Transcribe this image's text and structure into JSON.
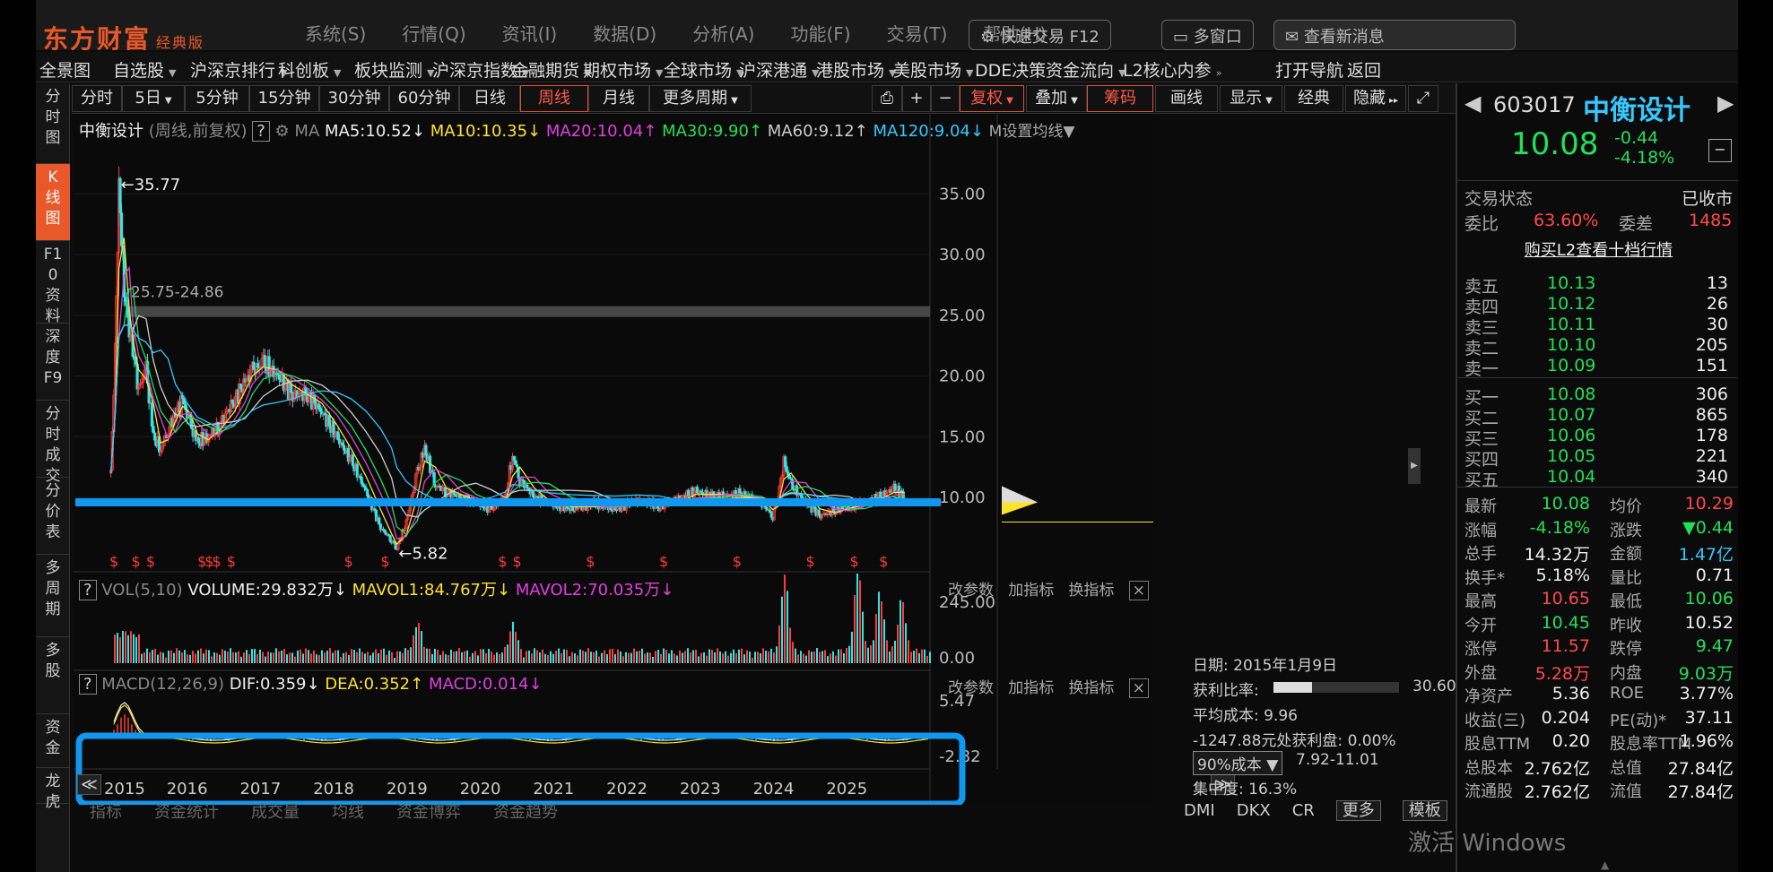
{
  "top_strip": {
    "logo": "东方财富",
    "logo_sub": "经典版",
    "menus": [
      "系统(S)",
      "行情(Q)",
      "资讯(I)",
      "数据(D)",
      "分析(A)",
      "功能(F)",
      "交易(T)",
      "帮助(H)"
    ],
    "search_pill": "快速交易 F12",
    "msg_pill": "多窗口",
    "news_pill": "查看新消息"
  },
  "main_nav": [
    {
      "label": "全景图",
      "arrow": ""
    },
    {
      "label": "自选股",
      "arrow": "▼"
    },
    {
      "label": "沪深京排行",
      "arrow": "▼"
    },
    {
      "label": "科创板",
      "arrow": "▼"
    },
    {
      "label": "板块监测",
      "arrow": "▼"
    },
    {
      "label": "沪深京指数",
      "arrow": "▼"
    },
    {
      "label": "金融期货",
      "arrow": "▼"
    },
    {
      "label": "期权市场",
      "arrow": "▼"
    },
    {
      "label": "全球市场",
      "arrow": "▼"
    },
    {
      "label": "沪深港通",
      "arrow": "▼"
    },
    {
      "label": "港股市场",
      "arrow": "▼"
    },
    {
      "label": "美股市场",
      "arrow": "▼"
    },
    {
      "label": "DDE决策",
      "arrow": ""
    },
    {
      "label": "资金流向",
      "arrow": "▼"
    },
    {
      "label": "L2核心内参",
      "arrow": "»"
    },
    {
      "label": "打开导航",
      "arrow": ""
    },
    {
      "label": "返回",
      "arrow": ""
    }
  ],
  "side_tabs": [
    {
      "label": "分时图",
      "active": false
    },
    {
      "label": "K线图",
      "active": true
    },
    {
      "label": "F10资料",
      "active": false
    },
    {
      "label": "深度F9",
      "active": false
    },
    {
      "label": "分时成交",
      "active": false
    },
    {
      "label": "分价表",
      "active": false
    },
    {
      "label": "多周期",
      "active": false
    },
    {
      "label": "多股",
      "active": false
    },
    {
      "label": "资金",
      "active": false
    },
    {
      "label": "龙虎",
      "active": false
    }
  ],
  "toolbar": {
    "periods": [
      {
        "label": "分时",
        "arrow": "",
        "active": false
      },
      {
        "label": "5日",
        "arrow": "▼",
        "active": false
      },
      {
        "label": "5分钟",
        "arrow": "",
        "active": false
      },
      {
        "label": "15分钟",
        "arrow": "",
        "active": false
      },
      {
        "label": "30分钟",
        "arrow": "",
        "active": false
      },
      {
        "label": "60分钟",
        "arrow": "",
        "active": false
      },
      {
        "label": "日线",
        "arrow": "",
        "active": false
      },
      {
        "label": "周线",
        "arrow": "",
        "active": true
      },
      {
        "label": "月线",
        "arrow": "",
        "active": false
      },
      {
        "label": "更多周期",
        "arrow": "▼",
        "active": false
      }
    ],
    "tools": [
      {
        "label": "⎙",
        "arrow": "",
        "active": false
      },
      {
        "label": "+",
        "arrow": "",
        "active": false
      },
      {
        "label": "−",
        "arrow": "",
        "active": false
      },
      {
        "label": "复权",
        "arrow": "▼",
        "active": true
      },
      {
        "label": "叠加",
        "arrow": "▼",
        "active": false
      },
      {
        "label": "筹码",
        "arrow": "",
        "active": true
      },
      {
        "label": "画线",
        "arrow": "",
        "active": false
      },
      {
        "label": "显示",
        "arrow": "▼",
        "active": false
      },
      {
        "label": "经典",
        "arrow": "",
        "active": false
      },
      {
        "label": "隐藏",
        "arrow": "▸▸",
        "active": false
      },
      {
        "label": "⤢",
        "arrow": "",
        "active": false
      }
    ]
  },
  "kline_header": {
    "name": "中衡设计",
    "mode": "(周线,前复权)",
    "help": "?",
    "ma": "MA",
    "ma5": "MA5:10.52↓",
    "ma10": "MA10:10.35↓",
    "ma20": "MA20:10.04↑",
    "ma30": "MA30:9.90↑",
    "ma60": "MA60:9.12↑",
    "ma120": "MA120:9.04↓",
    "ma_set": "M设置均线▼"
  },
  "vol_header": {
    "help": "?",
    "name": "VOL(5,10)",
    "volume": "VOLUME:29.832万↓",
    "mavol1": "MAVOL1:84.767万↓",
    "mavol2": "MAVOL2:70.035万↓"
  },
  "macd_header": {
    "help": "?",
    "name": "MACD(12,26,9)",
    "dif": "DIF:0.359↓",
    "dea": "DEA:0.352↑",
    "macd": "MACD:0.014↓"
  },
  "panel_buttons": {
    "params": "改参数",
    "add": "加指标",
    "switch": "换指标",
    "close": "×"
  },
  "chart_data": {
    "type": "candlestick",
    "period": "weekly",
    "price_axis_ticks": [
      35.0,
      30.0,
      25.0,
      20.0,
      15.0,
      10.0
    ],
    "vol_axis_ticks": [
      "245.00",
      "0.00"
    ],
    "macd_axis_ticks": [
      "5.47",
      "-2.82"
    ],
    "year_labels": [
      "2015",
      "2016",
      "2017",
      "2018",
      "2019",
      "2020",
      "2021",
      "2022",
      "2023",
      "2024",
      "2025"
    ],
    "annotations": {
      "high": "←35.77",
      "low": "←5.82",
      "band": "25.75-24.86"
    },
    "price_range": [
      5.82,
      35.77
    ],
    "band_range": [
      24.86,
      25.75
    ],
    "support_line": 9.6,
    "close_series": [
      [
        2015.02,
        12
      ],
      [
        2015.08,
        22
      ],
      [
        2015.13,
        35.77
      ],
      [
        2015.2,
        27
      ],
      [
        2015.27,
        24
      ],
      [
        2015.32,
        22
      ],
      [
        2015.4,
        19
      ],
      [
        2015.5,
        20.5
      ],
      [
        2015.6,
        15
      ],
      [
        2015.7,
        14
      ],
      [
        2015.8,
        15.5
      ],
      [
        2015.9,
        17
      ],
      [
        2016.0,
        18
      ],
      [
        2016.1,
        16
      ],
      [
        2016.2,
        14.5
      ],
      [
        2016.35,
        15
      ],
      [
        2016.5,
        16
      ],
      [
        2016.7,
        18
      ],
      [
        2016.85,
        19.5
      ],
      [
        2016.95,
        20.5
      ],
      [
        2017.1,
        21
      ],
      [
        2017.3,
        20
      ],
      [
        2017.5,
        18.5
      ],
      [
        2017.7,
        18.5
      ],
      [
        2017.9,
        17
      ],
      [
        2018.1,
        15
      ],
      [
        2018.3,
        13
      ],
      [
        2018.5,
        10.5
      ],
      [
        2018.7,
        7.5
      ],
      [
        2018.85,
        6.5
      ],
      [
        2018.92,
        5.82
      ],
      [
        2019.05,
        8
      ],
      [
        2019.2,
        12
      ],
      [
        2019.3,
        14
      ],
      [
        2019.45,
        11
      ],
      [
        2019.6,
        10.5
      ],
      [
        2019.8,
        10
      ],
      [
        2020.0,
        9.5
      ],
      [
        2020.2,
        9
      ],
      [
        2020.4,
        10
      ],
      [
        2020.5,
        13.5
      ],
      [
        2020.6,
        11.5
      ],
      [
        2020.8,
        10
      ],
      [
        2021.0,
        9.5
      ],
      [
        2021.3,
        9
      ],
      [
        2021.6,
        9.5
      ],
      [
        2021.9,
        9
      ],
      [
        2022.2,
        9.8
      ],
      [
        2022.5,
        9.3
      ],
      [
        2022.8,
        10
      ],
      [
        2023.0,
        10.5
      ],
      [
        2023.3,
        10
      ],
      [
        2023.6,
        10.3
      ],
      [
        2023.9,
        9.5
      ],
      [
        2024.05,
        8.5
      ],
      [
        2024.12,
        10
      ],
      [
        2024.2,
        13
      ],
      [
        2024.3,
        11
      ],
      [
        2024.5,
        9.6
      ],
      [
        2024.7,
        8.5
      ],
      [
        2024.9,
        9
      ],
      [
        2025.1,
        9.2
      ],
      [
        2025.3,
        9.6
      ],
      [
        2025.5,
        10
      ],
      [
        2025.7,
        10.8
      ],
      [
        2025.85,
        10.08
      ]
    ],
    "volume_spikes": [
      [
        2019.2,
        0.35
      ],
      [
        2020.5,
        0.3
      ],
      [
        2024.2,
        0.85
      ],
      [
        2025.2,
        0.95
      ],
      [
        2025.5,
        0.7
      ],
      [
        2025.8,
        0.6
      ]
    ],
    "signal_marks": [
      2015.0,
      2015.3,
      2015.5,
      2016.2,
      2016.3,
      2016.4,
      2016.6,
      2018.2,
      2018.7,
      2020.3,
      2020.5,
      2021.5,
      2022.5,
      2023.5,
      2024.5,
      2025.1,
      2025.5
    ]
  },
  "nav_arrows": {
    "left": "≪",
    "right": "≫"
  },
  "right_panel": {
    "code": "603017",
    "name": "中衡设计",
    "price": "10.08",
    "change": "-0.44",
    "change_pct": "-4.18%",
    "collapse": "−",
    "status_label": "交易状态",
    "status_value": "已收市",
    "wb_label": "委比",
    "wb_value": "63.60%",
    "wc_label": "委差",
    "wc_value": "1485",
    "l2_link": "购买L2查看十档行情",
    "asks": [
      [
        "卖五",
        "10.13",
        "13"
      ],
      [
        "卖四",
        "10.12",
        "26"
      ],
      [
        "卖三",
        "10.11",
        "30"
      ],
      [
        "卖二",
        "10.10",
        "205"
      ],
      [
        "卖一",
        "10.09",
        "151"
      ]
    ],
    "bids": [
      [
        "买一",
        "10.08",
        "306"
      ],
      [
        "买二",
        "10.07",
        "865"
      ],
      [
        "买三",
        "10.06",
        "178"
      ],
      [
        "买四",
        "10.05",
        "221"
      ],
      [
        "买五",
        "10.04",
        "340"
      ]
    ],
    "stats": [
      [
        [
          "最新",
          "10.08",
          "g"
        ],
        [
          "均价",
          "10.29",
          "r"
        ]
      ],
      [
        [
          "涨幅",
          "-4.18%",
          "g"
        ],
        [
          "涨跌",
          "▼0.44",
          "g"
        ]
      ],
      [
        [
          "总手",
          "14.32万",
          "w"
        ],
        [
          "金额",
          "1.47亿",
          "c"
        ]
      ],
      [
        [
          "换手*",
          "5.18%",
          "w"
        ],
        [
          "量比",
          "0.71",
          "w"
        ]
      ],
      [
        [
          "最高",
          "10.65",
          "r"
        ],
        [
          "最低",
          "10.06",
          "g"
        ]
      ],
      [
        [
          "今开",
          "10.45",
          "g"
        ],
        [
          "昨收",
          "10.52",
          "w"
        ]
      ],
      [
        [
          "涨停",
          "11.57",
          "r"
        ],
        [
          "跌停",
          "9.47",
          "g"
        ]
      ],
      [
        [
          "外盘",
          "5.28万",
          "r"
        ],
        [
          "内盘",
          "9.03万",
          "g"
        ]
      ],
      [
        [
          "净资产",
          "5.36",
          "w"
        ],
        [
          "ROE",
          "3.77%",
          "w"
        ]
      ],
      [
        [
          "收益(三)",
          "0.204",
          "w"
        ],
        [
          "PE(动)*",
          "37.11",
          "w"
        ]
      ],
      [
        [
          "股息TTM",
          "0.20",
          "w"
        ],
        [
          "股息率TTM",
          "1.96%",
          "w"
        ]
      ],
      [
        [
          "总股本",
          "2.762亿",
          "w"
        ],
        [
          "总值",
          "27.84亿",
          "w"
        ]
      ],
      [
        [
          "流通股",
          "2.762亿",
          "w"
        ],
        [
          "流值",
          "27.84亿",
          "w"
        ]
      ]
    ]
  },
  "cost_panel": {
    "date": "日期: 2015年1月9日",
    "profit_label": "获利比率:",
    "profit_value": "30.60%",
    "profit_ratio": 0.306,
    "avg": "平均成本: 9.96",
    "profit_at": "-1247.88元处获利盘: 0.00%",
    "cost_select": "90%成本 ▼",
    "cost_range": "7.92-11.01",
    "concentration": "集中度: 16.3%"
  },
  "bottom_tabs": [
    "DMI",
    "DKX",
    "CR",
    "更多",
    "模板"
  ],
  "bottom_left_tabs": [
    "指标",
    "资金统计",
    "成交量",
    "均线",
    "资金博弈",
    "资金趋势"
  ],
  "watermark": "激活 Windows",
  "colors": {
    "up": "#ff3b3b",
    "down": "#2ee6e6",
    "ma5": "#ffffff",
    "ma10": "#ffe22a",
    "ma20": "#e040e0",
    "ma30": "#22e05a",
    "ma60": "#cccccc",
    "ma120": "#35c8ff",
    "annotation_blue": "#1098f0",
    "accent": "#e8582a"
  }
}
